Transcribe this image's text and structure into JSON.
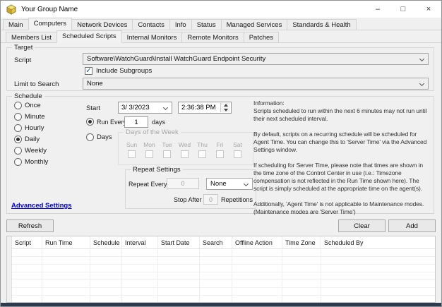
{
  "window": {
    "title": "Your Group Name",
    "minimize_glyph": "–",
    "maximize_glyph": "□",
    "close_glyph": "×"
  },
  "colors": {
    "panel_bg": "#f0f0f0",
    "titlebar_bg": "#ffffff",
    "link_blue": "#0000e0",
    "bottom_edge": "#2e3a4e",
    "app_icon_gold": "#e6c245"
  },
  "icons": {
    "app": "group-cube-icon",
    "checkmark": "✓"
  },
  "primary_tabs": {
    "active": "Computers",
    "items": [
      "Main",
      "Computers",
      "Network Devices",
      "Contacts",
      "Info",
      "Status",
      "Managed Services",
      "Standards & Health"
    ]
  },
  "secondary_tabs": {
    "active": "Scheduled Scripts",
    "items": [
      "Members List",
      "Scheduled Scripts",
      "Internal Monitors",
      "Remote Monitors",
      "Patches"
    ]
  },
  "target": {
    "group_label": "Target",
    "script_label": "Script",
    "script_value": "Software\\WatchGuard\\Install WatchGuard Endpoint Security",
    "include_subgroups_label": "Include Subgroups",
    "include_subgroups_checked": true,
    "limit_label": "Limit to Search",
    "limit_value": "None"
  },
  "schedule": {
    "group_label": "Schedule",
    "frequency_options": [
      "Once",
      "Minute",
      "Hourly",
      "Daily",
      "Weekly",
      "Monthly"
    ],
    "frequency_selected": "Daily",
    "start_label": "Start",
    "start_date": "3/ 3/2023",
    "start_time": "2:36:38 PM",
    "start_mode_selected": "Run Every",
    "run_every_label": "Run Every",
    "run_every_value": "1",
    "run_every_unit": "days",
    "days_label": "Days",
    "days_of_week": {
      "group_label": "Days of the Week",
      "days": [
        "Sun",
        "Mon",
        "Tue",
        "Wed",
        "Thu",
        "Fri",
        "Sat"
      ]
    },
    "repeat": {
      "group_label": "Repeat Settings",
      "repeat_every_label": "Repeat Every",
      "repeat_every_value": "0",
      "interval_value": "None",
      "stop_after_label": "Stop After",
      "stop_after_value": "0",
      "repetitions_label": "Repetitions"
    },
    "advanced_settings_label": "Advanced Settings"
  },
  "information": {
    "paragraphs": [
      "Information:\nScripts scheduled to run within the next 6 minutes may not run until\ntheir next scheduled interval.",
      "By default, scripts on a recurring schedule will be scheduled for\nAgent Time. You can change this to 'Server Time' via the Advanced\nSettings window.",
      "If scheduling for Server Time, please note that times are shown in\nthe time zone of the Control Center in use (i.e.: Timezone\ncompensation is not reflected in the Run Time shown here). The\nscript is simply scheduled at the appropriate time on the agent(s).",
      "Additionally, 'Agent Time' is not applicable to Maintenance modes.\n(Maintenance modes are 'Server Time')"
    ]
  },
  "actions": {
    "refresh_label": "Refresh",
    "clear_label": "Clear",
    "add_label": "Add"
  },
  "scripts_table": {
    "columns": [
      "Script",
      "Run Time",
      "Schedule",
      "Interval",
      "Start Date",
      "Search",
      "Offline Action",
      "Time Zone",
      "Scheduled By"
    ],
    "rows": []
  }
}
